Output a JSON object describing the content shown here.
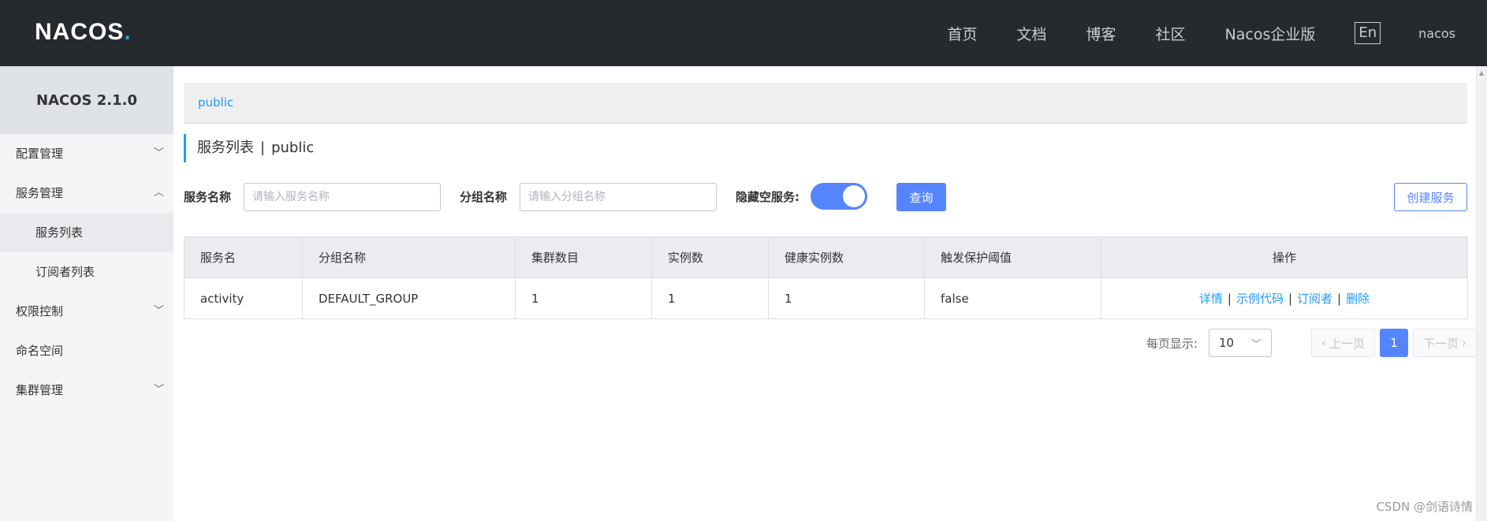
{
  "header": {
    "logo": "NACOS",
    "logo_dot": ".",
    "nav": [
      "首页",
      "文档",
      "博客",
      "社区",
      "Nacos企业版"
    ],
    "lang": "En",
    "user": "nacos"
  },
  "sidebar": {
    "title": "NACOS 2.1.0",
    "items": [
      {
        "label": "配置管理",
        "chevron": "down"
      },
      {
        "label": "服务管理",
        "chevron": "up"
      },
      {
        "label": "服务列表",
        "sub": true,
        "active": true
      },
      {
        "label": "订阅者列表",
        "sub": true
      },
      {
        "label": "权限控制",
        "chevron": "down"
      },
      {
        "label": "命名空间"
      },
      {
        "label": "集群管理",
        "chevron": "down"
      }
    ]
  },
  "namespace": {
    "current": "public"
  },
  "page": {
    "title": "服务列表",
    "separator": "|",
    "namespace": "public"
  },
  "filters": {
    "service_label": "服务名称",
    "service_placeholder": "请输入服务名称",
    "group_label": "分组名称",
    "group_placeholder": "请输入分组名称",
    "hide_empty_label": "隐藏空服务:",
    "hide_empty_on": true,
    "query_button": "查询",
    "create_button": "创建服务"
  },
  "table": {
    "columns": [
      "服务名",
      "分组名称",
      "集群数目",
      "实例数",
      "健康实例数",
      "触发保护阈值",
      "操作"
    ],
    "rows": [
      {
        "name": "activity",
        "group": "DEFAULT_GROUP",
        "clusters": "1",
        "instances": "1",
        "healthy": "1",
        "threshold": "false"
      }
    ],
    "actions": [
      "详情",
      "示例代码",
      "订阅者",
      "删除"
    ]
  },
  "pagination": {
    "per_page_label": "每页显示:",
    "page_size": "10",
    "prev": "上一页",
    "next": "下一页",
    "current": "1"
  },
  "watermark": "CSDN @剑语诗情",
  "colors": {
    "accent": "#5584ff",
    "link": "#209bfa",
    "header_bg": "#252a2f",
    "sidebar_bg": "#f4f5f7"
  }
}
